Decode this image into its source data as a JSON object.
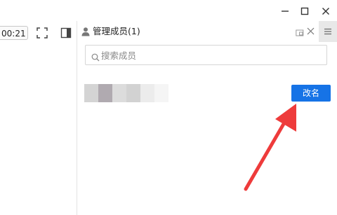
{
  "window": {
    "minimize_icon": "minimize-icon",
    "maximize_icon": "maximize-icon",
    "close_icon": "close-icon"
  },
  "toolbar": {
    "timer": "00:21",
    "fullscreen_icon": "fullscreen-icon",
    "panel_toggle_icon": "panel-toggle-icon"
  },
  "panel": {
    "title": "管理成员(1)",
    "user_icon": "user-icon",
    "popout_icon": "popout-icon",
    "close_icon": "close-icon",
    "menu_icon": "hamburger-menu-icon"
  },
  "search": {
    "placeholder": "搜索成员",
    "value": ""
  },
  "members": [
    {
      "name_obscured": true,
      "action_label": "改名"
    }
  ],
  "colors": {
    "accent": "#1673e6",
    "annotation_arrow": "#ee3b3b",
    "menu_button_bg": "#e8e8e8"
  }
}
